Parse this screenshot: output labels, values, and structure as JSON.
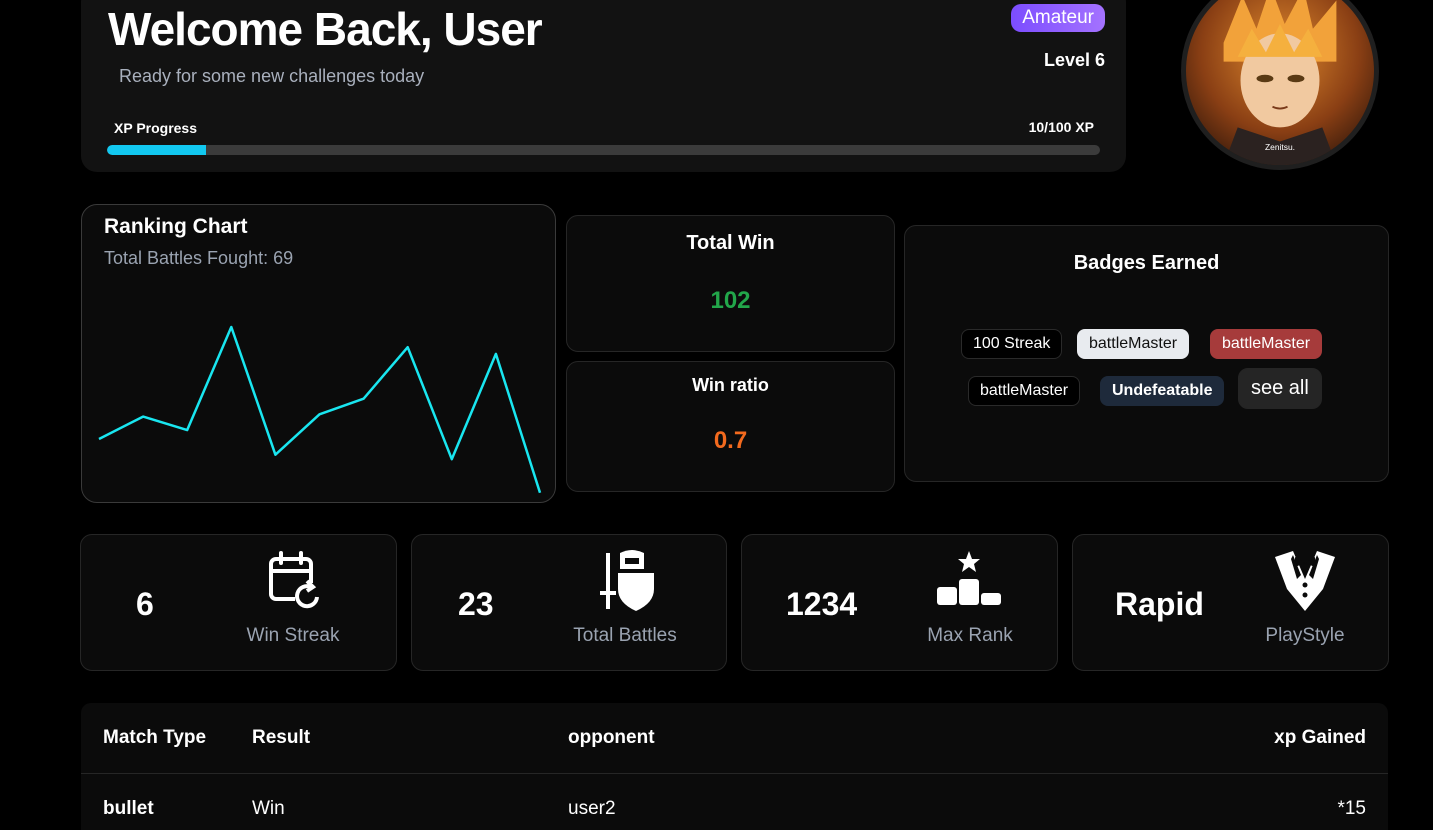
{
  "header": {
    "title": "Welcome Back, User",
    "subtitle": "Ready for some new challenges today",
    "tier": "Amateur",
    "level": "Level 6",
    "xp_label": "XP Progress",
    "xp_value": "10/100 XP",
    "xp_fraction": 0.1,
    "avatar_caption": "Zenitsu."
  },
  "ranking": {
    "title": "Ranking Chart",
    "subtitle": "Total Battles Fought: 69"
  },
  "chart_data": {
    "type": "line",
    "title": "Ranking Chart",
    "values": [
      25,
      35,
      29,
      75,
      18,
      36,
      43,
      66,
      16,
      63,
      1
    ],
    "ylim": [
      0,
      100
    ],
    "color": "#19e6f0",
    "grid": false
  },
  "stats": {
    "total_win_label": "Total Win",
    "total_win_value": "102",
    "win_ratio_label": "Win ratio",
    "win_ratio_value": "0.7"
  },
  "badges": {
    "title": "Badges Earned",
    "items": [
      "100 Streak",
      "battleMaster",
      "battleMaster",
      "battleMaster",
      "Undefeatable"
    ],
    "see_all": "see all"
  },
  "tiles": [
    {
      "value": "6",
      "label": "Win Streak",
      "icon": "calendar-refresh-icon"
    },
    {
      "value": "23",
      "label": "Total Battles",
      "icon": "knight-sword-shield-icon"
    },
    {
      "value": "1234",
      "label": "Max Rank",
      "icon": "podium-star-icon"
    },
    {
      "value": "Rapid",
      "label": "PlayStyle",
      "icon": "tuxedo-icon"
    }
  ],
  "table": {
    "headers": [
      "Match Type",
      "Result",
      "opponent",
      "xp Gained"
    ],
    "rows": [
      [
        "bullet",
        "Win",
        "user2",
        "*15"
      ]
    ]
  }
}
